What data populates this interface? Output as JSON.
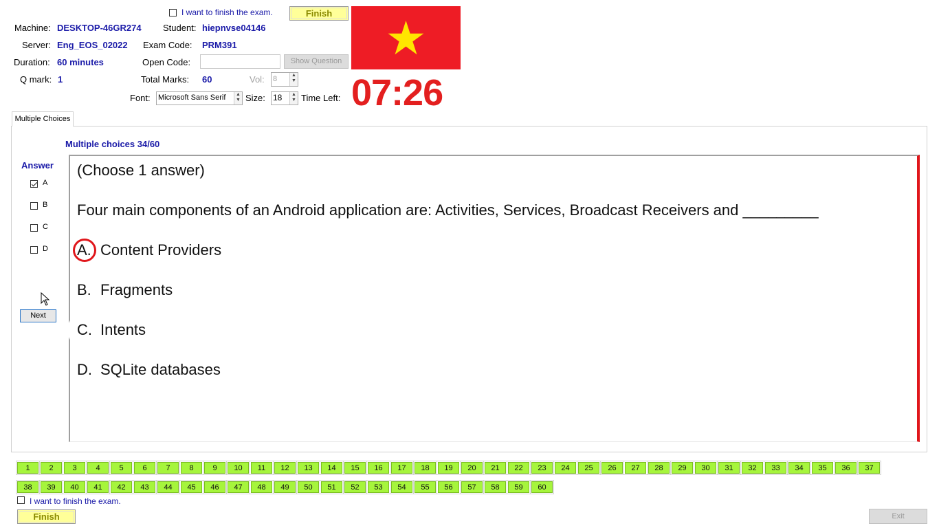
{
  "header": {
    "finish_checkbox_label": "I want to finish the exam.",
    "finish_checked": false,
    "finish_button": "Finish",
    "machine_label": "Machine:",
    "machine_value": "DESKTOP-46GR274",
    "student_label": "Student:",
    "student_value": "hiepnvse04146",
    "server_label": "Server:",
    "server_value": "Eng_EOS_02022",
    "exam_code_label": "Exam Code:",
    "exam_code_value": "PRM391",
    "duration_label": "Duration:",
    "duration_value": "60 minutes",
    "open_code_label": "Open Code:",
    "open_code_value": "",
    "show_question_button": "Show Question",
    "qmark_label": "Q mark:",
    "qmark_value": "1",
    "total_marks_label": "Total Marks:",
    "total_marks_value": "60",
    "vol_label": "Vol:",
    "vol_value": "8",
    "font_label": "Font:",
    "font_value": "Microsoft Sans Serif",
    "size_label": "Size:",
    "size_value": "18",
    "time_left_label": "Time Left:",
    "time_left_value": "07:26",
    "flag_color": "#ee1c25",
    "flag_star_color": "#ffe500"
  },
  "tab": {
    "label": "Multiple Choices"
  },
  "question": {
    "progress": "Multiple choices 34/60",
    "answer_heading": "Answer",
    "answers": [
      {
        "label": "A",
        "checked": true
      },
      {
        "label": "B",
        "checked": false
      },
      {
        "label": "C",
        "checked": false
      },
      {
        "label": "D",
        "checked": false
      }
    ],
    "next_button": "Next",
    "instruction": "(Choose 1 answer)",
    "text": "Four main components of an Android application are: Activities, Services, Broadcast Receivers and _________",
    "options": [
      {
        "letter": "A.",
        "text": "Content Providers"
      },
      {
        "letter": "B.",
        "text": "Fragments"
      },
      {
        "letter": "C.",
        "text": "Intents"
      },
      {
        "letter": "D.",
        "text": "SQLite databases"
      }
    ]
  },
  "navigation": {
    "question_numbers": [
      "1",
      "2",
      "3",
      "4",
      "5",
      "6",
      "7",
      "8",
      "9",
      "10",
      "11",
      "12",
      "13",
      "14",
      "15",
      "16",
      "17",
      "18",
      "19",
      "20",
      "21",
      "22",
      "23",
      "24",
      "25",
      "26",
      "27",
      "28",
      "29",
      "30",
      "31",
      "32",
      "33",
      "34",
      "35",
      "36",
      "37",
      "38",
      "39",
      "40",
      "41",
      "42",
      "43",
      "44",
      "45",
      "46",
      "47",
      "48",
      "49",
      "50",
      "51",
      "52",
      "53",
      "54",
      "55",
      "56",
      "57",
      "58",
      "59",
      "60"
    ],
    "button_color": "#a6f53c"
  },
  "footer": {
    "finish_checkbox_label": "I want to finish the exam.",
    "finish_button": "Finish",
    "exit_button": "Exit"
  }
}
